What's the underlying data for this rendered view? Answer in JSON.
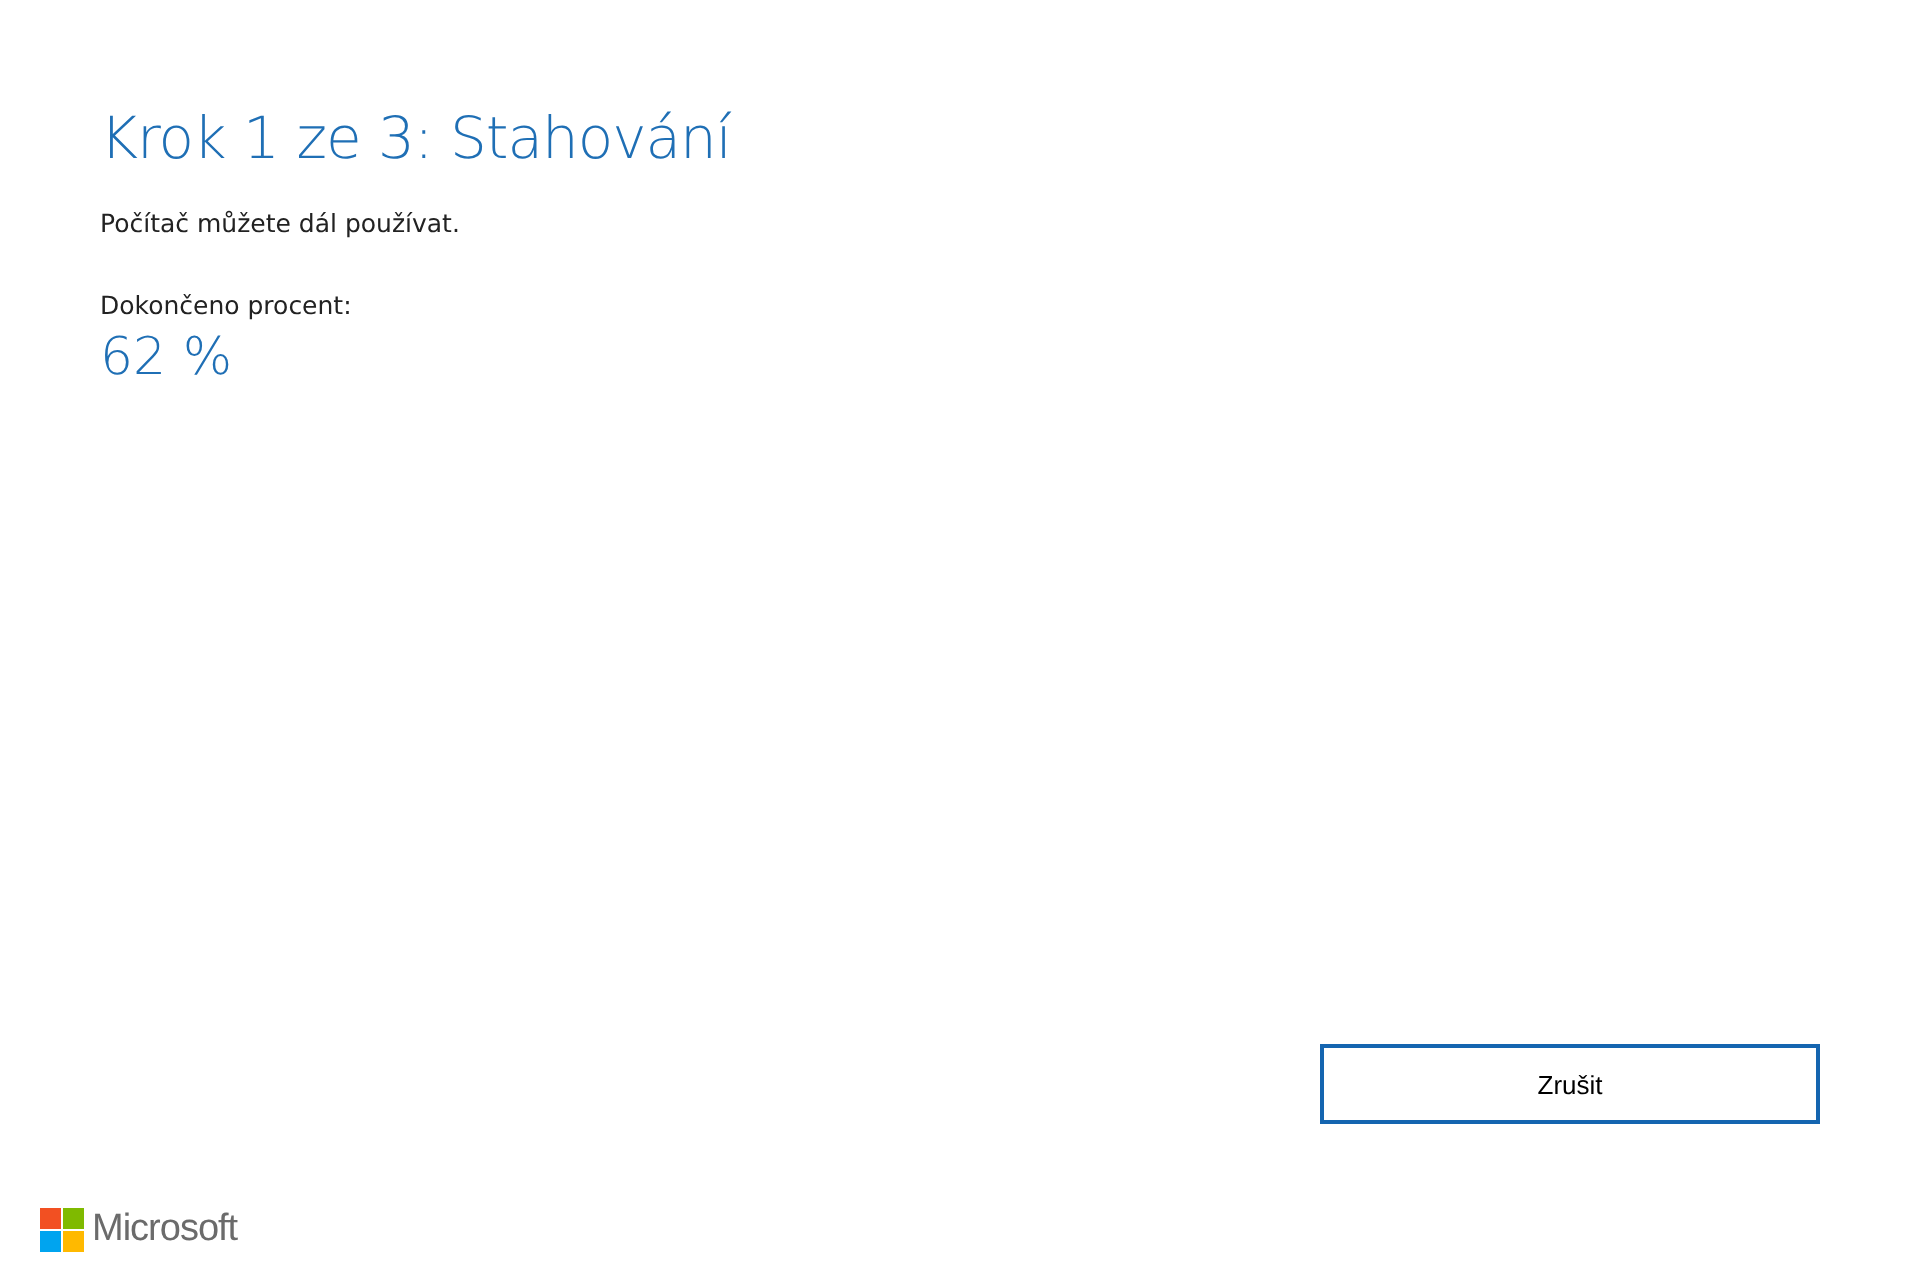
{
  "title": "Krok 1 ze 3: Stahování",
  "subtitle": "Počítač můžete dál používat.",
  "progress_label": "Dokončeno procent:",
  "progress_value": "62 %",
  "buttons": [
    {
      "label": "Zrušit"
    }
  ],
  "footer": {
    "logo_text": "Microsoft"
  }
}
